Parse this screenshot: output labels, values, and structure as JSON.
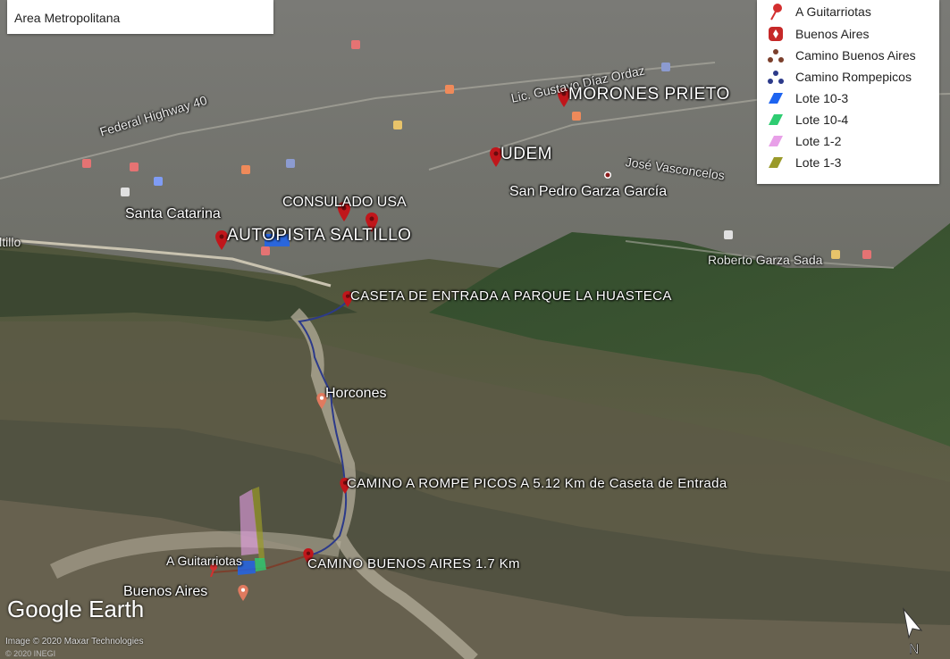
{
  "header": {
    "area_label": "Area Metropolitana"
  },
  "legend": {
    "items": [
      {
        "label": "A Guitarriotas",
        "icon": "red-pushpin-icon",
        "color": "#d32f2f"
      },
      {
        "label": "Buenos Aires",
        "icon": "red-marker-square-icon",
        "color": "#c62828"
      },
      {
        "label": "Camino Buenos Aires",
        "icon": "path-brown-icon",
        "color": "#7b3f2c"
      },
      {
        "label": "Camino Rompepicos",
        "icon": "path-blue-icon",
        "color": "#2c3a8a"
      },
      {
        "label": "Lote 10-3",
        "icon": "polygon-blue-icon",
        "color": "#1e64f0"
      },
      {
        "label": "Lote 10-4",
        "icon": "polygon-green-icon",
        "color": "#2ecc71"
      },
      {
        "label": "Lote 1-2",
        "icon": "polygon-pink-icon",
        "color": "#e8a0e8"
      },
      {
        "label": "Lote 1-3",
        "icon": "polygon-olive-icon",
        "color": "#9a9a2a"
      }
    ]
  },
  "places": {
    "morones_prieto": "MORONES PRIETO",
    "udem": "UDEM",
    "san_pedro": "San Pedro Garza García",
    "santa_catarina": "Santa Catarina",
    "consulado": "CONSULADO USA",
    "autopista": "AUTOPISTA SALTILLO",
    "caseta": "CASETA DE ENTRADA A PARQUE LA HUASTECA",
    "horcones": "Horcones",
    "camino_rompe": "CAMINO A ROMPE PICOS A 5.12 Km de Caseta de Entrada",
    "camino_buenos": "CAMINO BUENOS AIRES  1.7 Km",
    "a_guitarriotas": "A Guitarriotas",
    "buenos_aires": "Buenos Aires"
  },
  "roads": {
    "federal": "Federal Highway 40",
    "gustavo": "Lic. Gustavo Díaz Ordaz",
    "vasconcelos": "José Vasconcelos",
    "roberto": "Roberto Garza Sada",
    "saltillo": "Saltillo"
  },
  "branding": {
    "logo": "Google Earth",
    "credit": "Image © 2020 Maxar Technologies",
    "credit2": "© 2020 INEGI"
  }
}
